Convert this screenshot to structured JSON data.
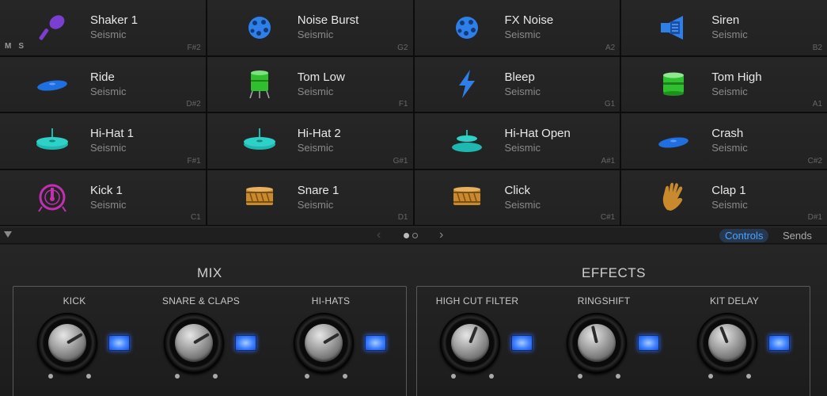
{
  "pads": [
    {
      "name": "Shaker 1",
      "sub": "Seismic",
      "note": "F#2",
      "icon": "shaker-icon",
      "color": "#7a3fd0"
    },
    {
      "name": "Noise Burst",
      "sub": "Seismic",
      "note": "G2",
      "icon": "noise-ball-icon",
      "color": "#2f7fe8"
    },
    {
      "name": "FX Noise",
      "sub": "Seismic",
      "note": "A2",
      "icon": "noise-ball-icon",
      "color": "#2f7fe8"
    },
    {
      "name": "Siren",
      "sub": "Seismic",
      "note": "B2",
      "icon": "speaker-icon",
      "color": "#2f7fe8"
    },
    {
      "name": "Ride",
      "sub": "Seismic",
      "note": "D#2",
      "icon": "cymbal-flat-icon",
      "color": "#1f6fe0"
    },
    {
      "name": "Tom Low",
      "sub": "Seismic",
      "note": "F1",
      "icon": "floor-tom-icon",
      "color": "#2fbf2f"
    },
    {
      "name": "Bleep",
      "sub": "Seismic",
      "note": "G1",
      "icon": "lightning-icon",
      "color": "#2f7fe8"
    },
    {
      "name": "Tom High",
      "sub": "Seismic",
      "note": "A1",
      "icon": "tom-drum-icon",
      "color": "#2fbf2f"
    },
    {
      "name": "Hi-Hat 1",
      "sub": "Seismic",
      "note": "F#1",
      "icon": "hihat-icon",
      "color": "#1fb8b0"
    },
    {
      "name": "Hi-Hat 2",
      "sub": "Seismic",
      "note": "G#1",
      "icon": "hihat-icon",
      "color": "#1fb8b0"
    },
    {
      "name": "Hi-Hat Open",
      "sub": "Seismic",
      "note": "A#1",
      "icon": "hihat-open-icon",
      "color": "#1fb8b0"
    },
    {
      "name": "Crash",
      "sub": "Seismic",
      "note": "C#2",
      "icon": "cymbal-flat-icon",
      "color": "#1f6fe0"
    },
    {
      "name": "Kick 1",
      "sub": "Seismic",
      "note": "C1",
      "icon": "kick-drum-icon",
      "color": "#c030b0"
    },
    {
      "name": "Snare 1",
      "sub": "Seismic",
      "note": "D1",
      "icon": "snare-drum-icon",
      "color": "#c98a2e"
    },
    {
      "name": "Click",
      "sub": "Seismic",
      "note": "C#1",
      "icon": "snare-drum-icon",
      "color": "#c98a2e"
    },
    {
      "name": "Clap 1",
      "sub": "Seismic",
      "note": "D#1",
      "icon": "clap-hand-icon",
      "color": "#c98a2e"
    }
  ],
  "pad_flags": {
    "mute": "M",
    "solo": "S"
  },
  "pager": {
    "prev": "‹",
    "next": "›",
    "current_page": 1,
    "page_count": 2
  },
  "tabs": {
    "controls": "Controls",
    "sends": "Sends",
    "active": "controls"
  },
  "mix": {
    "title": "MIX",
    "knobs": [
      {
        "label": "KICK",
        "value": 0.72
      },
      {
        "label": "SNARE & CLAPS",
        "value": 0.72
      },
      {
        "label": "HI-HATS",
        "value": 0.72
      }
    ]
  },
  "effects": {
    "title": "EFFECTS",
    "knobs": [
      {
        "label": "HIGH CUT FILTER",
        "value": 0.58
      },
      {
        "label": "RINGSHIFT",
        "value": 0.45
      },
      {
        "label": "KIT DELAY",
        "value": 0.42
      }
    ]
  },
  "colors": {
    "accent": "#4aa3ff",
    "led": "#3d80ff"
  }
}
